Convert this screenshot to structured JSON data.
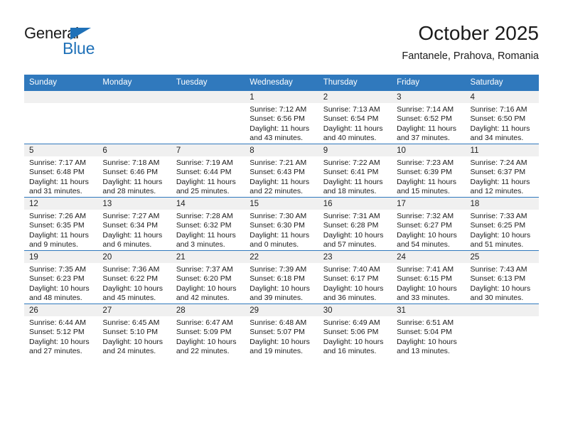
{
  "brand": {
    "name_part1": "General",
    "name_part2": "Blue",
    "triangle_color": "#1f71b8"
  },
  "header": {
    "title": "October 2025",
    "subtitle": "Fantanele, Prahova, Romania"
  },
  "theme": {
    "header_blue": "#3079bd",
    "daynum_band": "#f0f0f0",
    "text": "#1b1b1b"
  },
  "weekday_headers": [
    "Sunday",
    "Monday",
    "Tuesday",
    "Wednesday",
    "Thursday",
    "Friday",
    "Saturday"
  ],
  "weeks": [
    [
      {
        "day": "",
        "empty": true,
        "sunrise": "",
        "sunset": "",
        "daylight_line1": "",
        "daylight_line2": ""
      },
      {
        "day": "",
        "empty": true,
        "sunrise": "",
        "sunset": "",
        "daylight_line1": "",
        "daylight_line2": ""
      },
      {
        "day": "",
        "empty": true,
        "sunrise": "",
        "sunset": "",
        "daylight_line1": "",
        "daylight_line2": ""
      },
      {
        "day": "1",
        "empty": false,
        "sunrise": "Sunrise: 7:12 AM",
        "sunset": "Sunset: 6:56 PM",
        "daylight_line1": "Daylight: 11 hours",
        "daylight_line2": "and 43 minutes."
      },
      {
        "day": "2",
        "empty": false,
        "sunrise": "Sunrise: 7:13 AM",
        "sunset": "Sunset: 6:54 PM",
        "daylight_line1": "Daylight: 11 hours",
        "daylight_line2": "and 40 minutes."
      },
      {
        "day": "3",
        "empty": false,
        "sunrise": "Sunrise: 7:14 AM",
        "sunset": "Sunset: 6:52 PM",
        "daylight_line1": "Daylight: 11 hours",
        "daylight_line2": "and 37 minutes."
      },
      {
        "day": "4",
        "empty": false,
        "sunrise": "Sunrise: 7:16 AM",
        "sunset": "Sunset: 6:50 PM",
        "daylight_line1": "Daylight: 11 hours",
        "daylight_line2": "and 34 minutes."
      }
    ],
    [
      {
        "day": "5",
        "empty": false,
        "sunrise": "Sunrise: 7:17 AM",
        "sunset": "Sunset: 6:48 PM",
        "daylight_line1": "Daylight: 11 hours",
        "daylight_line2": "and 31 minutes."
      },
      {
        "day": "6",
        "empty": false,
        "sunrise": "Sunrise: 7:18 AM",
        "sunset": "Sunset: 6:46 PM",
        "daylight_line1": "Daylight: 11 hours",
        "daylight_line2": "and 28 minutes."
      },
      {
        "day": "7",
        "empty": false,
        "sunrise": "Sunrise: 7:19 AM",
        "sunset": "Sunset: 6:44 PM",
        "daylight_line1": "Daylight: 11 hours",
        "daylight_line2": "and 25 minutes."
      },
      {
        "day": "8",
        "empty": false,
        "sunrise": "Sunrise: 7:21 AM",
        "sunset": "Sunset: 6:43 PM",
        "daylight_line1": "Daylight: 11 hours",
        "daylight_line2": "and 22 minutes."
      },
      {
        "day": "9",
        "empty": false,
        "sunrise": "Sunrise: 7:22 AM",
        "sunset": "Sunset: 6:41 PM",
        "daylight_line1": "Daylight: 11 hours",
        "daylight_line2": "and 18 minutes."
      },
      {
        "day": "10",
        "empty": false,
        "sunrise": "Sunrise: 7:23 AM",
        "sunset": "Sunset: 6:39 PM",
        "daylight_line1": "Daylight: 11 hours",
        "daylight_line2": "and 15 minutes."
      },
      {
        "day": "11",
        "empty": false,
        "sunrise": "Sunrise: 7:24 AM",
        "sunset": "Sunset: 6:37 PM",
        "daylight_line1": "Daylight: 11 hours",
        "daylight_line2": "and 12 minutes."
      }
    ],
    [
      {
        "day": "12",
        "empty": false,
        "sunrise": "Sunrise: 7:26 AM",
        "sunset": "Sunset: 6:35 PM",
        "daylight_line1": "Daylight: 11 hours",
        "daylight_line2": "and 9 minutes."
      },
      {
        "day": "13",
        "empty": false,
        "sunrise": "Sunrise: 7:27 AM",
        "sunset": "Sunset: 6:34 PM",
        "daylight_line1": "Daylight: 11 hours",
        "daylight_line2": "and 6 minutes."
      },
      {
        "day": "14",
        "empty": false,
        "sunrise": "Sunrise: 7:28 AM",
        "sunset": "Sunset: 6:32 PM",
        "daylight_line1": "Daylight: 11 hours",
        "daylight_line2": "and 3 minutes."
      },
      {
        "day": "15",
        "empty": false,
        "sunrise": "Sunrise: 7:30 AM",
        "sunset": "Sunset: 6:30 PM",
        "daylight_line1": "Daylight: 11 hours",
        "daylight_line2": "and 0 minutes."
      },
      {
        "day": "16",
        "empty": false,
        "sunrise": "Sunrise: 7:31 AM",
        "sunset": "Sunset: 6:28 PM",
        "daylight_line1": "Daylight: 10 hours",
        "daylight_line2": "and 57 minutes."
      },
      {
        "day": "17",
        "empty": false,
        "sunrise": "Sunrise: 7:32 AM",
        "sunset": "Sunset: 6:27 PM",
        "daylight_line1": "Daylight: 10 hours",
        "daylight_line2": "and 54 minutes."
      },
      {
        "day": "18",
        "empty": false,
        "sunrise": "Sunrise: 7:33 AM",
        "sunset": "Sunset: 6:25 PM",
        "daylight_line1": "Daylight: 10 hours",
        "daylight_line2": "and 51 minutes."
      }
    ],
    [
      {
        "day": "19",
        "empty": false,
        "sunrise": "Sunrise: 7:35 AM",
        "sunset": "Sunset: 6:23 PM",
        "daylight_line1": "Daylight: 10 hours",
        "daylight_line2": "and 48 minutes."
      },
      {
        "day": "20",
        "empty": false,
        "sunrise": "Sunrise: 7:36 AM",
        "sunset": "Sunset: 6:22 PM",
        "daylight_line1": "Daylight: 10 hours",
        "daylight_line2": "and 45 minutes."
      },
      {
        "day": "21",
        "empty": false,
        "sunrise": "Sunrise: 7:37 AM",
        "sunset": "Sunset: 6:20 PM",
        "daylight_line1": "Daylight: 10 hours",
        "daylight_line2": "and 42 minutes."
      },
      {
        "day": "22",
        "empty": false,
        "sunrise": "Sunrise: 7:39 AM",
        "sunset": "Sunset: 6:18 PM",
        "daylight_line1": "Daylight: 10 hours",
        "daylight_line2": "and 39 minutes."
      },
      {
        "day": "23",
        "empty": false,
        "sunrise": "Sunrise: 7:40 AM",
        "sunset": "Sunset: 6:17 PM",
        "daylight_line1": "Daylight: 10 hours",
        "daylight_line2": "and 36 minutes."
      },
      {
        "day": "24",
        "empty": false,
        "sunrise": "Sunrise: 7:41 AM",
        "sunset": "Sunset: 6:15 PM",
        "daylight_line1": "Daylight: 10 hours",
        "daylight_line2": "and 33 minutes."
      },
      {
        "day": "25",
        "empty": false,
        "sunrise": "Sunrise: 7:43 AM",
        "sunset": "Sunset: 6:13 PM",
        "daylight_line1": "Daylight: 10 hours",
        "daylight_line2": "and 30 minutes."
      }
    ],
    [
      {
        "day": "26",
        "empty": false,
        "sunrise": "Sunrise: 6:44 AM",
        "sunset": "Sunset: 5:12 PM",
        "daylight_line1": "Daylight: 10 hours",
        "daylight_line2": "and 27 minutes."
      },
      {
        "day": "27",
        "empty": false,
        "sunrise": "Sunrise: 6:45 AM",
        "sunset": "Sunset: 5:10 PM",
        "daylight_line1": "Daylight: 10 hours",
        "daylight_line2": "and 24 minutes."
      },
      {
        "day": "28",
        "empty": false,
        "sunrise": "Sunrise: 6:47 AM",
        "sunset": "Sunset: 5:09 PM",
        "daylight_line1": "Daylight: 10 hours",
        "daylight_line2": "and 22 minutes."
      },
      {
        "day": "29",
        "empty": false,
        "sunrise": "Sunrise: 6:48 AM",
        "sunset": "Sunset: 5:07 PM",
        "daylight_line1": "Daylight: 10 hours",
        "daylight_line2": "and 19 minutes."
      },
      {
        "day": "30",
        "empty": false,
        "sunrise": "Sunrise: 6:49 AM",
        "sunset": "Sunset: 5:06 PM",
        "daylight_line1": "Daylight: 10 hours",
        "daylight_line2": "and 16 minutes."
      },
      {
        "day": "31",
        "empty": false,
        "sunrise": "Sunrise: 6:51 AM",
        "sunset": "Sunset: 5:04 PM",
        "daylight_line1": "Daylight: 10 hours",
        "daylight_line2": "and 13 minutes."
      },
      {
        "day": "",
        "empty": true,
        "sunrise": "",
        "sunset": "",
        "daylight_line1": "",
        "daylight_line2": ""
      }
    ]
  ]
}
